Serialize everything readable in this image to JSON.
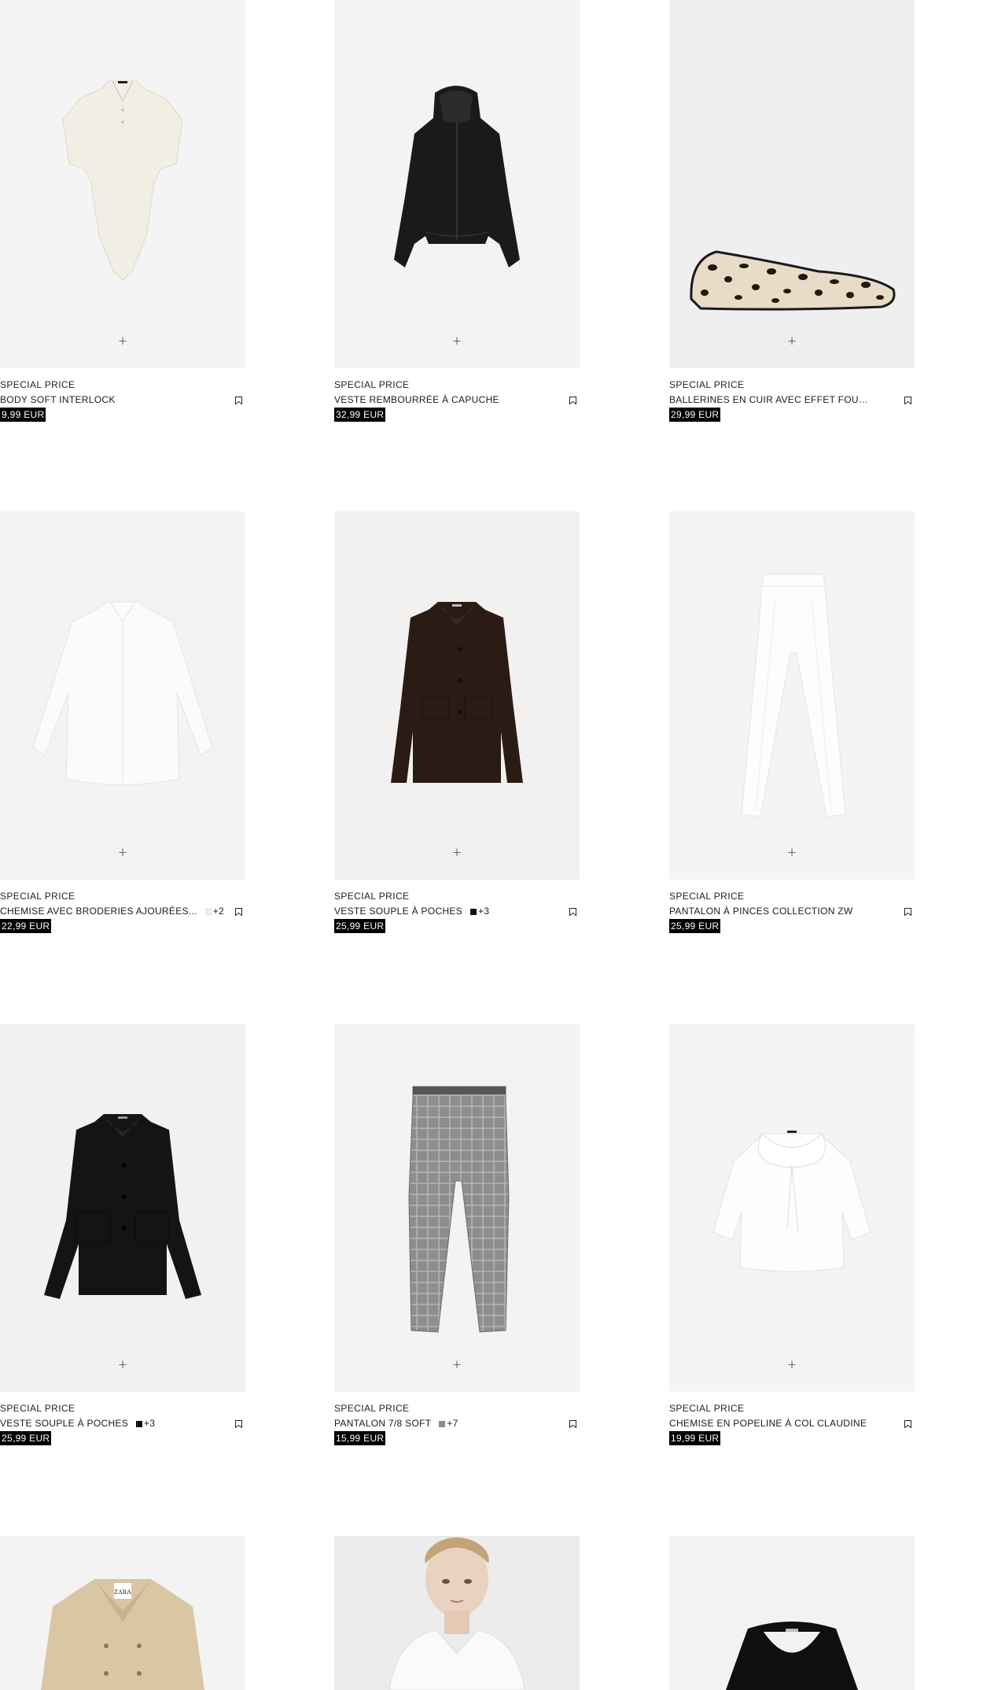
{
  "products": [
    {
      "tag": "SPECIAL PRICE",
      "name": "BODY SOFT INTERLOCK",
      "price": "9,99 EUR",
      "swatch": null,
      "add": "+",
      "image": "white-bodysuit"
    },
    {
      "tag": "SPECIAL PRICE",
      "name": "VESTE REMBOURRÉE À CAPUCHE",
      "price": "32,99 EUR",
      "swatch": null,
      "add": "+",
      "image": "black-puffer-jacket"
    },
    {
      "tag": "SPECIAL PRICE",
      "name": "BALLERINES EN CUIR AVEC EFFET FOURRU...",
      "price": "29,99 EUR",
      "swatch": null,
      "add": "+",
      "image": "leopard-ballet-flat"
    },
    {
      "tag": "SPECIAL PRICE",
      "name": "CHEMISE AVEC BRODERIES AJOURÉES...",
      "price": "22,99 EUR",
      "swatch": {
        "color": "#efefef",
        "more": "+2"
      },
      "add": "+",
      "image": "white-eyelet-shirt"
    },
    {
      "tag": "SPECIAL PRICE",
      "name": "VESTE SOUPLE À POCHES",
      "price": "25,99 EUR",
      "swatch": {
        "color": "#111111",
        "more": "+3"
      },
      "add": "+",
      "image": "brown-jacket"
    },
    {
      "tag": "SPECIAL PRICE",
      "name": "PANTALON À PINCES COLLECTION ZW",
      "price": "25,99 EUR",
      "swatch": null,
      "add": "+",
      "image": "white-trousers"
    },
    {
      "tag": "SPECIAL PRICE",
      "name": "VESTE SOUPLE À POCHES",
      "price": "25,99 EUR",
      "swatch": {
        "color": "#111111",
        "more": "+3"
      },
      "add": "+",
      "image": "black-jacket"
    },
    {
      "tag": "SPECIAL PRICE",
      "name": "PANTALON 7/8 SOFT",
      "price": "15,99 EUR",
      "swatch": {
        "color": "#8a8a8a",
        "more": "+7"
      },
      "add": "+",
      "image": "grey-check-trousers"
    },
    {
      "tag": "SPECIAL PRICE",
      "name": "CHEMISE EN POPELINE À COL CLAUDINE",
      "price": "19,99 EUR",
      "swatch": null,
      "add": "+",
      "image": "white-collar-blouse"
    }
  ],
  "partial_row": [
    {
      "image": "beige-trench-coat",
      "label_logo": "ZARA"
    },
    {
      "image": "model-white-shirt"
    },
    {
      "image": "black-top"
    }
  ],
  "icons": {
    "bookmark": "bookmark-icon",
    "add": "plus-icon"
  }
}
